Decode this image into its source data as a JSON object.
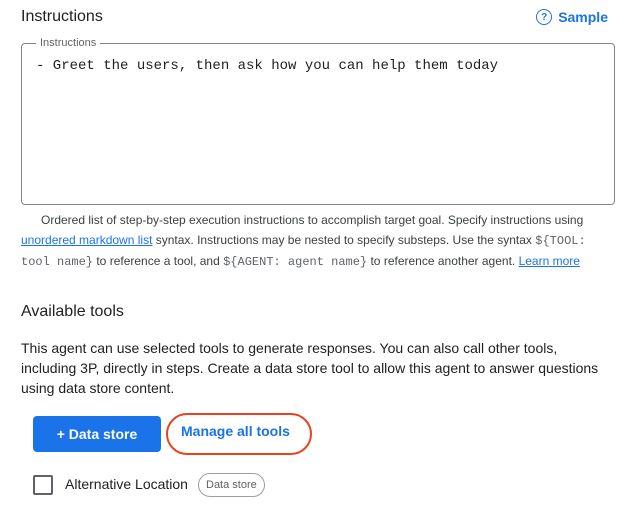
{
  "instructions": {
    "title": "Instructions",
    "sample_label": "Sample",
    "field_label": "Instructions",
    "field_value": "- Greet the users, then ask how you can help them today",
    "helper": {
      "part1": "Ordered list of step-by-step execution instructions to accomplish target goal. Specify instructions using ",
      "link1": "unordered markdown list",
      "part2": " syntax. Instructions may be nested to specify substeps. Use the syntax ",
      "code1": "${TOOL: tool name}",
      "part3": " to reference a tool, and ",
      "code2": "${AGENT: agent name}",
      "part4": " to reference another agent. ",
      "link2": "Learn more"
    }
  },
  "tools": {
    "title": "Available tools",
    "description": "This agent can use selected tools to generate responses. You can also call other tools, including 3P, directly in steps. Create a data store tool to allow this agent to answer questions using data store content.",
    "add_data_store_label": "+ Data store",
    "manage_tools_label": "Manage all tools",
    "items": [
      {
        "label": "Alternative Location",
        "chip": "Data store",
        "checked": false
      }
    ]
  },
  "colors": {
    "accent": "#1a73e8",
    "highlight": "#e8431f"
  }
}
